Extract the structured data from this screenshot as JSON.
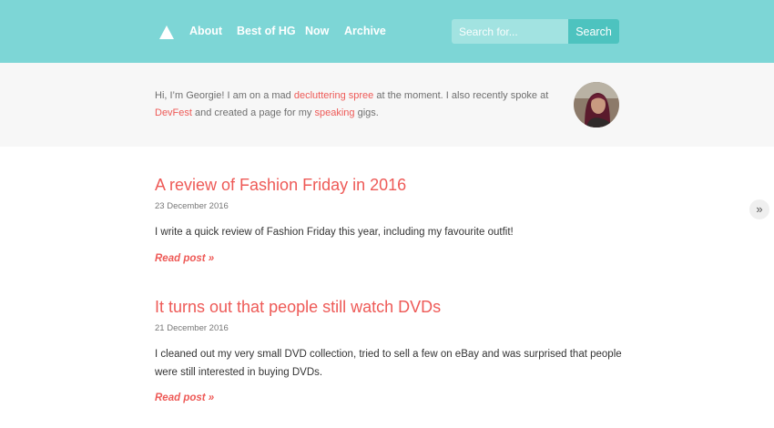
{
  "header": {
    "nav": [
      "About",
      "Best of HG",
      "Now",
      "Archive"
    ],
    "search": {
      "placeholder": "Search for...",
      "value": "",
      "button_label": "Search"
    }
  },
  "intro": {
    "t1": "Hi, I’m Georgie! I am on a mad ",
    "link1": "decluttering spree",
    "t2": " at the moment. I also recently spoke at ",
    "link2": "DevFest",
    "t3": " and created a page for my ",
    "link3": "speaking",
    "t4": " gigs."
  },
  "posts": [
    {
      "title": "A review of Fashion Friday in 2016",
      "date": "23 December 2016",
      "excerpt": "I write a quick review of Fashion Friday this year, including my favourite outfit!",
      "read_more": "Read post »"
    },
    {
      "title": "It turns out that people still watch DVDs",
      "date": "21 December 2016",
      "excerpt": "I cleaned out my very small DVD collection, tried to sell a few on eBay and was surprised that people were still interested in buying DVDs.",
      "read_more": "Read post »"
    }
  ],
  "next_button": "»",
  "colors": {
    "header_bg": "#7dd6d6",
    "accent": "#ee5a57",
    "search_button": "#4dc3bf",
    "intro_bg": "#f7f7f7"
  },
  "icons": {
    "logo": "triangle-logo-icon",
    "avatar": "profile-photo"
  }
}
